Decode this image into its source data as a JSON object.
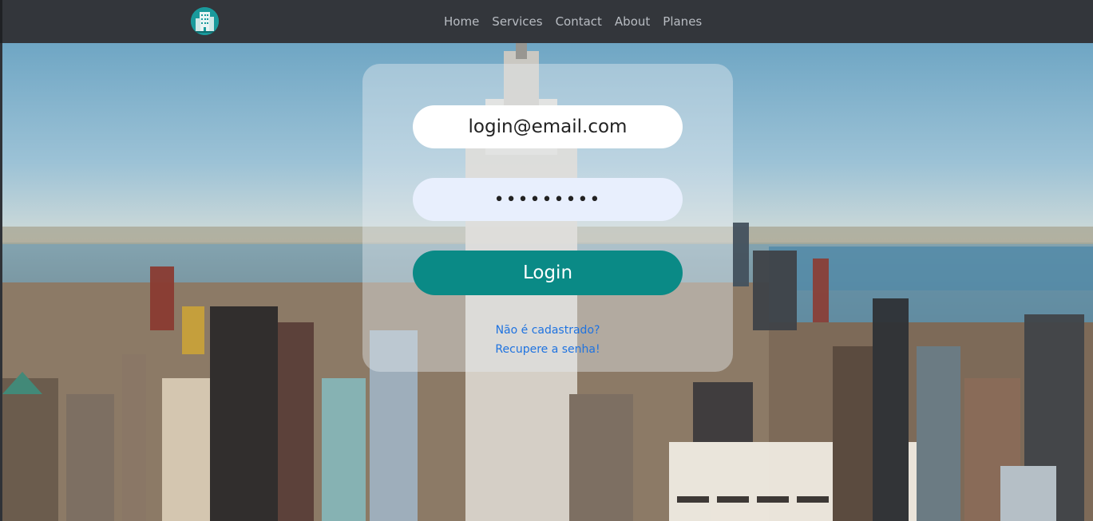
{
  "navbar": {
    "logo_icon": "building-icon",
    "links": [
      "Home",
      "Services",
      "Contact",
      "About",
      "Planes"
    ]
  },
  "login": {
    "email_value": "login@email.com",
    "password_value": "•••••••••",
    "button_label": "Login",
    "signup_link": "Não é cadastrado?",
    "recover_link": "Recupere a senha!"
  },
  "colors": {
    "navbar_bg": "#33363b",
    "accent": "#0a8a86",
    "link": "#1f73e0"
  },
  "background": {
    "subject": "city-skyline-photo"
  }
}
